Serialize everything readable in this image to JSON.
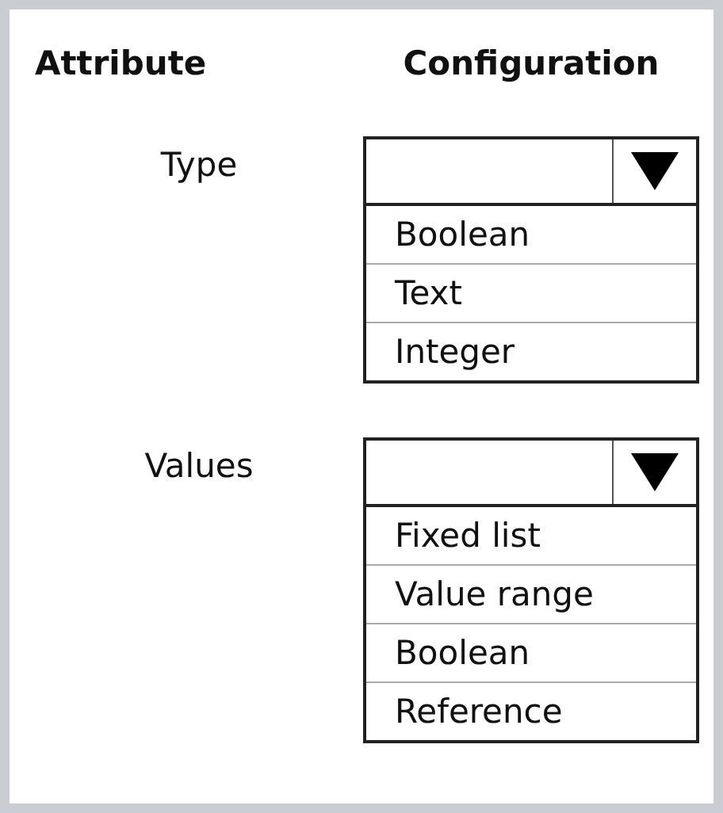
{
  "headers": [
    "Attribute",
    "Configuration"
  ],
  "rows": [
    {
      "label": "Type",
      "options": [
        "Boolean",
        "Text",
        "Integer"
      ]
    },
    {
      "label": "Values",
      "options": [
        "Fixed list",
        "Value range",
        "Boolean",
        "Reference"
      ]
    }
  ]
}
